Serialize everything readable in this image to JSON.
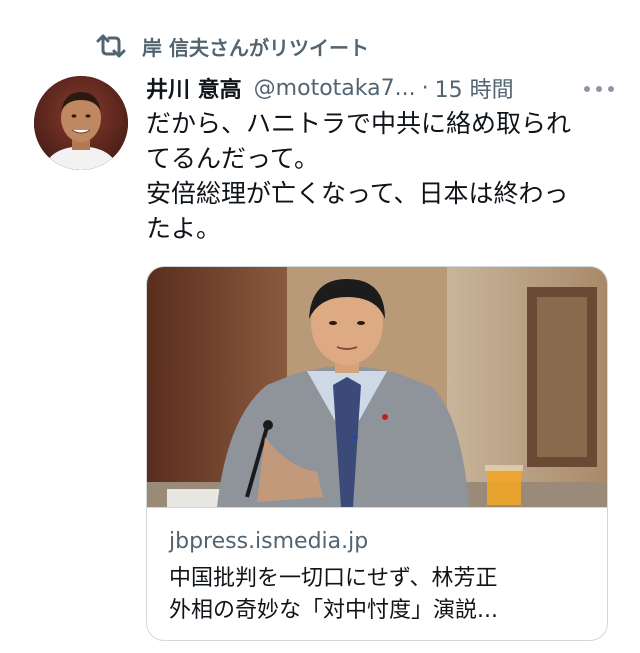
{
  "retweet": {
    "icon": "retweet-icon",
    "label": "岸 信夫さんがリツイート"
  },
  "tweet": {
    "display_name": "井川 意高",
    "handle": "@mototaka7...",
    "separator": "·",
    "time": "15 時間",
    "more_icon": "more-icon",
    "text_lines": [
      "だから、ハニトラで中共に絡め取られ",
      "てるんだって。",
      "安倍総理が亡くなって、日本は終わっ",
      "たよ。"
    ]
  },
  "card": {
    "domain": "jbpress.ismedia.jp",
    "title_lines": [
      "中国批判を一切口にせず、林芳正",
      "外相の奇妙な「対中忖度」演説..."
    ]
  },
  "colors": {
    "primary_text": "#0f1419",
    "secondary_text": "#536471",
    "border": "#cfd9de"
  }
}
